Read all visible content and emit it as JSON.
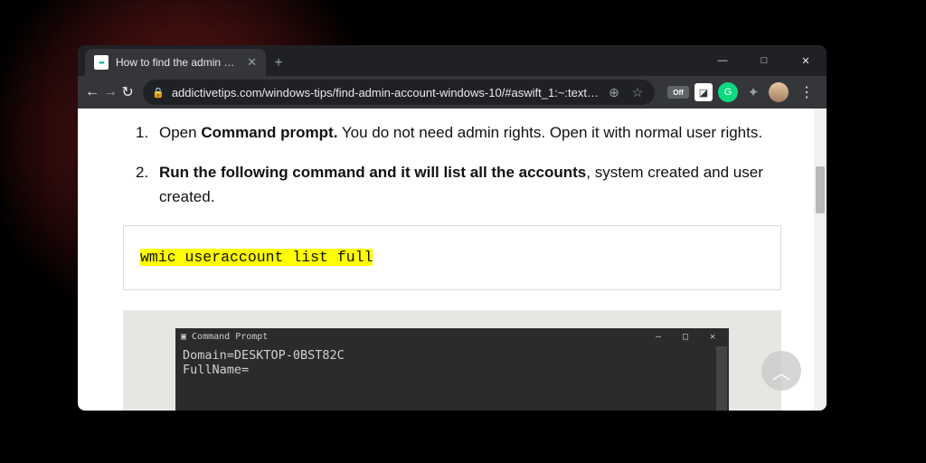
{
  "window": {
    "minimize": "—",
    "maximize": "□",
    "close": "✕"
  },
  "tab": {
    "title": "How to find the admin account o",
    "close": "✕",
    "new_tab": "+"
  },
  "nav": {
    "back": "←",
    "forward": "→",
    "reload": "↻"
  },
  "omnibox": {
    "lock": "🔒",
    "url": "addictivetips.com/windows-tips/find-admin-account-windows-10/#aswift_1:~:text…",
    "zoom": "⊕",
    "star": "☆"
  },
  "extensions": {
    "off_label": "Off",
    "puzzle": "✦",
    "menu": "⋮"
  },
  "article": {
    "steps": [
      {
        "num": "1.",
        "lead": "Open ",
        "bold": "Command prompt.",
        "tail": " You do not need admin rights. Open it with normal user rights."
      },
      {
        "num": "2.",
        "bold": "Run the following command and it will list all the accounts",
        "tail": ", system created and user created."
      }
    ],
    "code": "wmic useraccount list full"
  },
  "cmd": {
    "title": "Command Prompt",
    "min": "—",
    "max": "□",
    "close": "✕",
    "lines": [
      "Domain=DESKTOP-0BST82C",
      "FullName="
    ]
  },
  "backtop": "︿"
}
